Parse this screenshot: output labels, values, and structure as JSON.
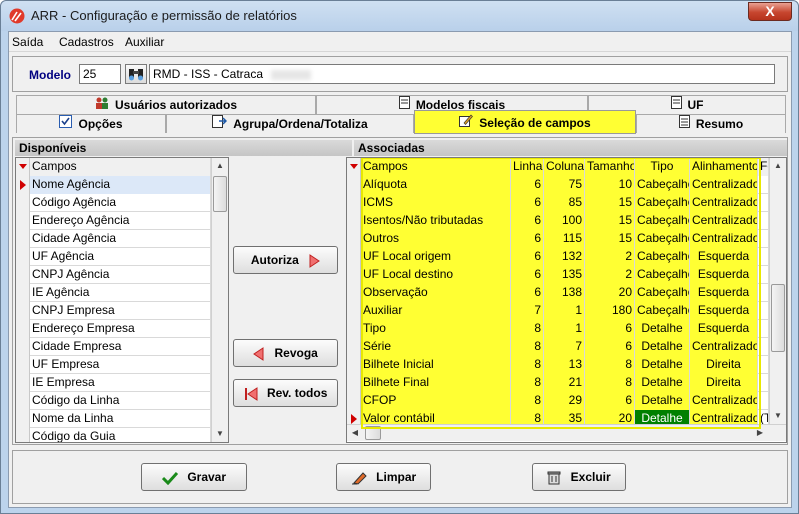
{
  "window": {
    "title": "ARR - Configuração e permissão de relatórios",
    "close_label": "X"
  },
  "menu": [
    "Saída",
    "Cadastros",
    "Auxiliar"
  ],
  "model": {
    "label": "Modelo",
    "code": "25",
    "name": "RMD - ISS - Catraca"
  },
  "tabs_row1": [
    {
      "label": "Usuários autorizados",
      "icon": "users-icon"
    },
    {
      "label": "Modelos fiscais",
      "icon": "document-icon"
    },
    {
      "label": "UF",
      "icon": "document-icon"
    }
  ],
  "tabs_row2": [
    {
      "label": "Opções",
      "icon": "checkbox-icon"
    },
    {
      "label": "Agrupa/Ordena/Totaliza",
      "icon": "export-icon"
    },
    {
      "label": "Seleção de campos",
      "icon": "edit-icon"
    },
    {
      "label": "Resumo",
      "icon": "document-icon"
    }
  ],
  "available": {
    "title": "Disponíveis",
    "column": "Campos",
    "items": [
      "Nome Agência",
      "Código Agência",
      "Endereço Agência",
      "Cidade Agência",
      "UF Agência",
      "CNPJ Agência",
      "IE Agência",
      "CNPJ Empresa",
      "Endereço Empresa",
      "Cidade Empresa",
      "UF Empresa",
      "IE Empresa",
      "Código da Linha",
      "Nome da Linha",
      "Código da Guia"
    ]
  },
  "buttons": {
    "autoriza": "Autoriza",
    "revoga": "Revoga",
    "rev_todos": "Rev. todos",
    "gravar": "Gravar",
    "limpar": "Limpar",
    "excluir": "Excluir"
  },
  "associated": {
    "title": "Associadas",
    "columns": [
      "Campos",
      "Linha",
      "Coluna",
      "Tamanho",
      "Tipo",
      "Alinhamento",
      "Fo"
    ],
    "rows": [
      [
        "Alíquota",
        "6",
        "75",
        "10",
        "Cabeçalho",
        "Centralizado"
      ],
      [
        "ICMS",
        "6",
        "85",
        "15",
        "Cabeçalho",
        "Centralizado"
      ],
      [
        "Isentos/Não tributadas",
        "6",
        "100",
        "15",
        "Cabeçalho",
        "Centralizado"
      ],
      [
        "Outros",
        "6",
        "115",
        "15",
        "Cabeçalho",
        "Centralizado"
      ],
      [
        "UF Local origem",
        "6",
        "132",
        "2",
        "Cabeçalho",
        "Esquerda"
      ],
      [
        "UF Local destino",
        "6",
        "135",
        "2",
        "Cabeçalho",
        "Esquerda"
      ],
      [
        "Observação",
        "6",
        "138",
        "20",
        "Cabeçalho",
        "Esquerda"
      ],
      [
        "Auxiliar",
        "7",
        "1",
        "180",
        "Cabeçalho",
        "Esquerda"
      ],
      [
        "Tipo",
        "8",
        "1",
        "6",
        "Detalhe",
        "Esquerda"
      ],
      [
        "Série",
        "8",
        "7",
        "6",
        "Detalhe",
        "Centralizado"
      ],
      [
        "Bilhete Inicial",
        "8",
        "13",
        "8",
        "Detalhe",
        "Direita"
      ],
      [
        "Bilhete Final",
        "8",
        "21",
        "8",
        "Detalhe",
        "Direita"
      ],
      [
        "CFOP",
        "8",
        "29",
        "6",
        "Detalhe",
        "Centralizado"
      ],
      [
        "Valor contábil",
        "8",
        "35",
        "20",
        "Detalhe",
        "Centralizado"
      ]
    ],
    "last_extra": "(T"
  },
  "colors": {
    "highlight": "#ffff33",
    "selected_green": "#008000",
    "indicator": "#d00000"
  }
}
